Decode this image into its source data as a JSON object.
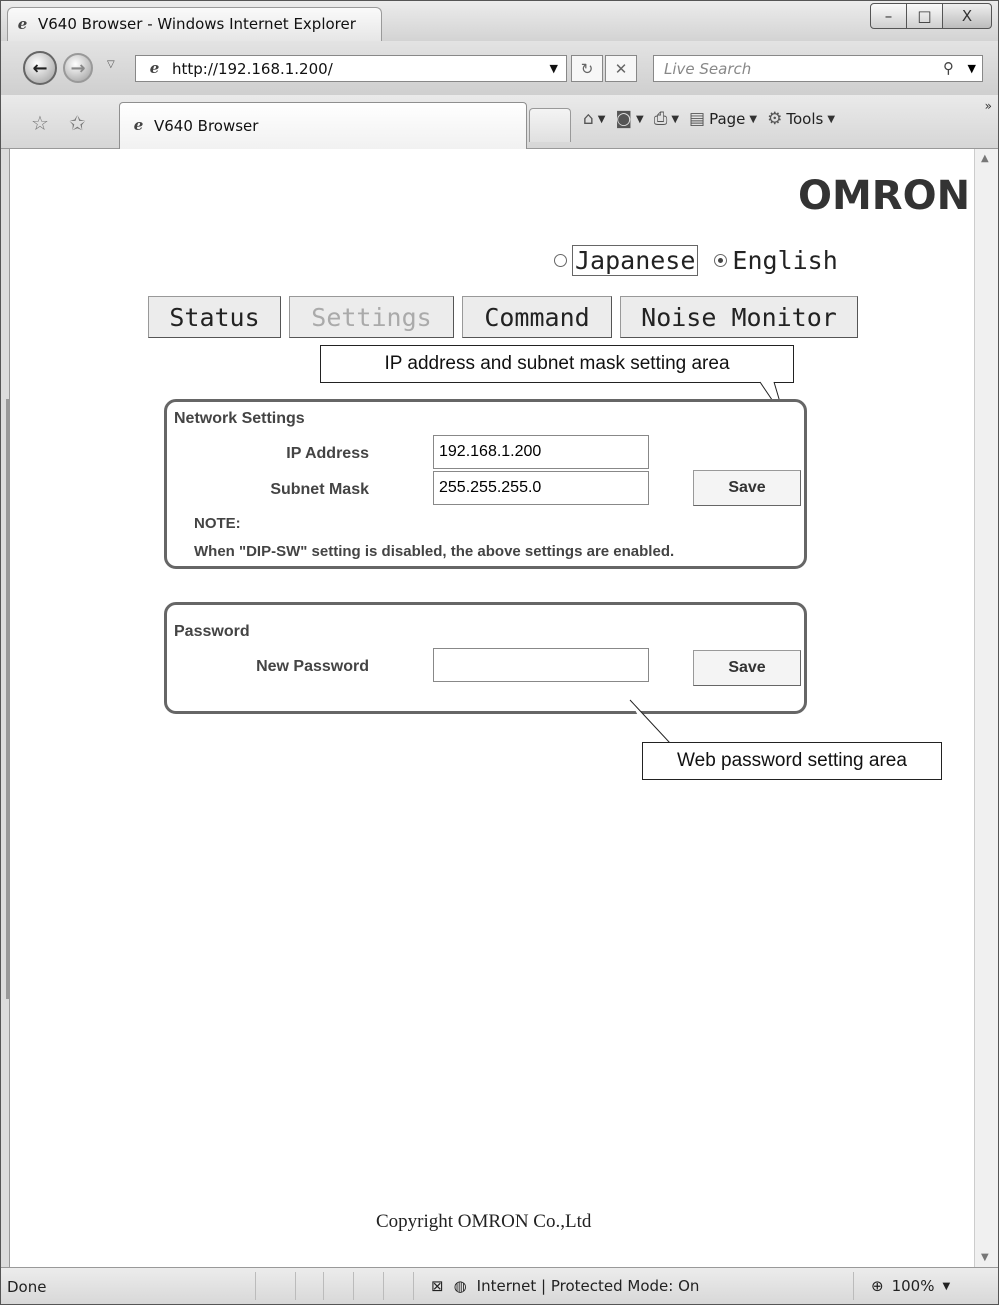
{
  "window": {
    "title": "V640 Browser - Windows Internet Explorer",
    "min_glyph": "–",
    "max_glyph": "□",
    "close_glyph": "X"
  },
  "addressbar": {
    "url": "http://192.168.1.200/",
    "search_placeholder": "Live Search"
  },
  "tabs": {
    "active_label": "V640 Browser"
  },
  "commandbar": {
    "page_label": "Page",
    "tools_label": "Tools"
  },
  "page": {
    "brand": "OMRON",
    "language": {
      "options": [
        "Japanese",
        "English"
      ],
      "selected": "English"
    },
    "nav": {
      "status": "Status",
      "settings": "Settings",
      "command": "Command",
      "noise_monitor": "Noise Monitor",
      "active": "Settings"
    },
    "callouts": {
      "network": "IP address and subnet mask setting area",
      "password": "Web password setting area"
    },
    "network": {
      "title": "Network Settings",
      "ip_label": "IP Address",
      "ip_value": "192.168.1.200",
      "mask_label": "Subnet Mask",
      "mask_value": "255.255.255.0",
      "save_label": "Save",
      "note_label": "NOTE:",
      "note_text": "When \"DIP-SW\" setting is disabled, the above settings are enabled."
    },
    "password": {
      "title": "Password",
      "new_label": "New Password",
      "new_value": "",
      "save_label": "Save"
    },
    "copyright": "Copyright OMRON Co.,Ltd"
  },
  "statusbar": {
    "left": "Done",
    "zone": "Internet | Protected Mode: On",
    "zoom": "100%"
  }
}
